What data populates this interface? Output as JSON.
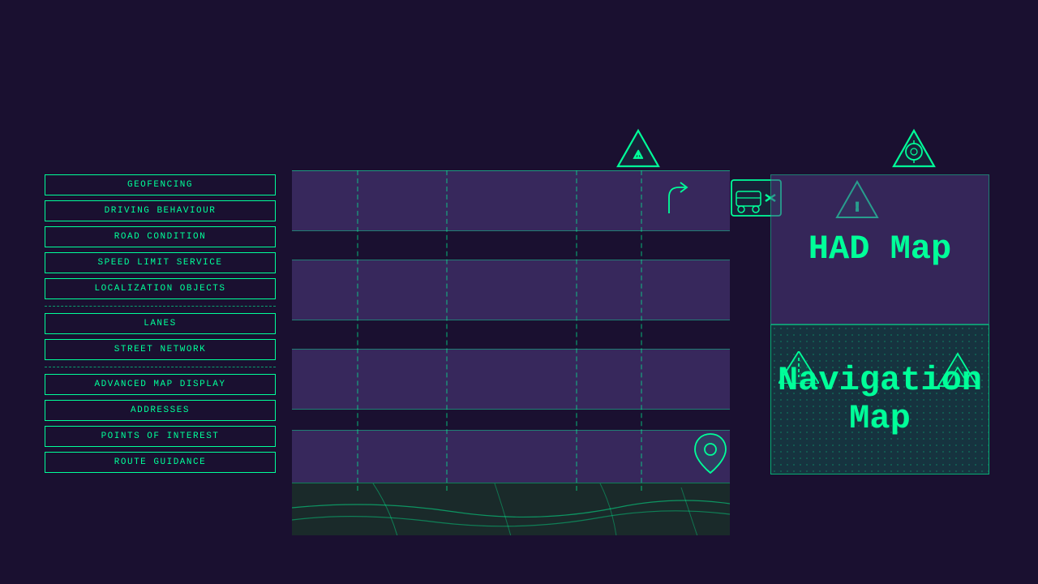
{
  "sidebar": {
    "group1": {
      "items": [
        "GEOFENCING",
        "DRIVING BEHAVIOUR",
        "ROAD CONDITION",
        "SPEED LIMIT SERVICE",
        "LOCALIZATION OBJECTS"
      ]
    },
    "group2": {
      "items": [
        "LANES",
        "STREET NETWORK"
      ]
    },
    "group3": {
      "items": [
        "ADVANCED MAP DISPLAY",
        "ADDRESSES",
        "POINTS OF INTEREST",
        "ROUTE GUIDANCE"
      ]
    }
  },
  "right_panel": {
    "had_map_label": "HAD Map",
    "nav_map_label": "Navigation\nMap"
  },
  "colors": {
    "accent": "#00ff99",
    "bg": "#1a1030",
    "layer": "rgba(80,60,130,0.55)"
  }
}
